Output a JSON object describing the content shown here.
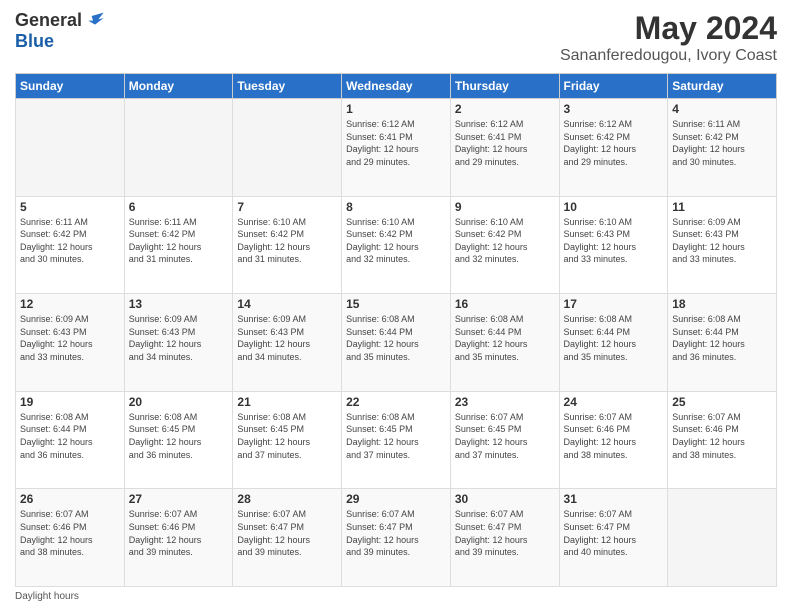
{
  "logo": {
    "general": "General",
    "blue": "Blue"
  },
  "header": {
    "title": "May 2024",
    "subtitle": "Sananferedougou, Ivory Coast"
  },
  "weekdays": [
    "Sunday",
    "Monday",
    "Tuesday",
    "Wednesday",
    "Thursday",
    "Friday",
    "Saturday"
  ],
  "footer": {
    "daylight_label": "Daylight hours"
  },
  "weeks": [
    [
      {
        "day": "",
        "info": ""
      },
      {
        "day": "",
        "info": ""
      },
      {
        "day": "",
        "info": ""
      },
      {
        "day": "1",
        "info": "Sunrise: 6:12 AM\nSunset: 6:41 PM\nDaylight: 12 hours\nand 29 minutes."
      },
      {
        "day": "2",
        "info": "Sunrise: 6:12 AM\nSunset: 6:41 PM\nDaylight: 12 hours\nand 29 minutes."
      },
      {
        "day": "3",
        "info": "Sunrise: 6:12 AM\nSunset: 6:42 PM\nDaylight: 12 hours\nand 29 minutes."
      },
      {
        "day": "4",
        "info": "Sunrise: 6:11 AM\nSunset: 6:42 PM\nDaylight: 12 hours\nand 30 minutes."
      }
    ],
    [
      {
        "day": "5",
        "info": "Sunrise: 6:11 AM\nSunset: 6:42 PM\nDaylight: 12 hours\nand 30 minutes."
      },
      {
        "day": "6",
        "info": "Sunrise: 6:11 AM\nSunset: 6:42 PM\nDaylight: 12 hours\nand 31 minutes."
      },
      {
        "day": "7",
        "info": "Sunrise: 6:10 AM\nSunset: 6:42 PM\nDaylight: 12 hours\nand 31 minutes."
      },
      {
        "day": "8",
        "info": "Sunrise: 6:10 AM\nSunset: 6:42 PM\nDaylight: 12 hours\nand 32 minutes."
      },
      {
        "day": "9",
        "info": "Sunrise: 6:10 AM\nSunset: 6:42 PM\nDaylight: 12 hours\nand 32 minutes."
      },
      {
        "day": "10",
        "info": "Sunrise: 6:10 AM\nSunset: 6:43 PM\nDaylight: 12 hours\nand 33 minutes."
      },
      {
        "day": "11",
        "info": "Sunrise: 6:09 AM\nSunset: 6:43 PM\nDaylight: 12 hours\nand 33 minutes."
      }
    ],
    [
      {
        "day": "12",
        "info": "Sunrise: 6:09 AM\nSunset: 6:43 PM\nDaylight: 12 hours\nand 33 minutes."
      },
      {
        "day": "13",
        "info": "Sunrise: 6:09 AM\nSunset: 6:43 PM\nDaylight: 12 hours\nand 34 minutes."
      },
      {
        "day": "14",
        "info": "Sunrise: 6:09 AM\nSunset: 6:43 PM\nDaylight: 12 hours\nand 34 minutes."
      },
      {
        "day": "15",
        "info": "Sunrise: 6:08 AM\nSunset: 6:44 PM\nDaylight: 12 hours\nand 35 minutes."
      },
      {
        "day": "16",
        "info": "Sunrise: 6:08 AM\nSunset: 6:44 PM\nDaylight: 12 hours\nand 35 minutes."
      },
      {
        "day": "17",
        "info": "Sunrise: 6:08 AM\nSunset: 6:44 PM\nDaylight: 12 hours\nand 35 minutes."
      },
      {
        "day": "18",
        "info": "Sunrise: 6:08 AM\nSunset: 6:44 PM\nDaylight: 12 hours\nand 36 minutes."
      }
    ],
    [
      {
        "day": "19",
        "info": "Sunrise: 6:08 AM\nSunset: 6:44 PM\nDaylight: 12 hours\nand 36 minutes."
      },
      {
        "day": "20",
        "info": "Sunrise: 6:08 AM\nSunset: 6:45 PM\nDaylight: 12 hours\nand 36 minutes."
      },
      {
        "day": "21",
        "info": "Sunrise: 6:08 AM\nSunset: 6:45 PM\nDaylight: 12 hours\nand 37 minutes."
      },
      {
        "day": "22",
        "info": "Sunrise: 6:08 AM\nSunset: 6:45 PM\nDaylight: 12 hours\nand 37 minutes."
      },
      {
        "day": "23",
        "info": "Sunrise: 6:07 AM\nSunset: 6:45 PM\nDaylight: 12 hours\nand 37 minutes."
      },
      {
        "day": "24",
        "info": "Sunrise: 6:07 AM\nSunset: 6:46 PM\nDaylight: 12 hours\nand 38 minutes."
      },
      {
        "day": "25",
        "info": "Sunrise: 6:07 AM\nSunset: 6:46 PM\nDaylight: 12 hours\nand 38 minutes."
      }
    ],
    [
      {
        "day": "26",
        "info": "Sunrise: 6:07 AM\nSunset: 6:46 PM\nDaylight: 12 hours\nand 38 minutes."
      },
      {
        "day": "27",
        "info": "Sunrise: 6:07 AM\nSunset: 6:46 PM\nDaylight: 12 hours\nand 39 minutes."
      },
      {
        "day": "28",
        "info": "Sunrise: 6:07 AM\nSunset: 6:47 PM\nDaylight: 12 hours\nand 39 minutes."
      },
      {
        "day": "29",
        "info": "Sunrise: 6:07 AM\nSunset: 6:47 PM\nDaylight: 12 hours\nand 39 minutes."
      },
      {
        "day": "30",
        "info": "Sunrise: 6:07 AM\nSunset: 6:47 PM\nDaylight: 12 hours\nand 39 minutes."
      },
      {
        "day": "31",
        "info": "Sunrise: 6:07 AM\nSunset: 6:47 PM\nDaylight: 12 hours\nand 40 minutes."
      },
      {
        "day": "",
        "info": ""
      }
    ]
  ]
}
